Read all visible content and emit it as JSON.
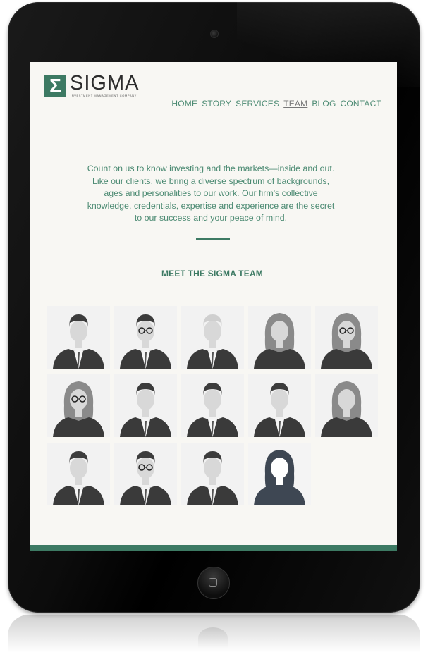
{
  "brand": {
    "mark": "Σ",
    "name": "SIGMA",
    "tagline": "INVESTMENT MANAGEMENT COMPANY"
  },
  "nav": {
    "items": [
      {
        "label": "HOME",
        "active": false
      },
      {
        "label": "STORY",
        "active": false
      },
      {
        "label": "SERVICES",
        "active": false
      },
      {
        "label": "TEAM",
        "active": true
      },
      {
        "label": "BLOG",
        "active": false
      },
      {
        "label": "CONTACT",
        "active": false
      }
    ]
  },
  "intro": {
    "text": "Count on us to know investing and the markets—inside and out. Like our clients, we bring a diverse spectrum of backgrounds, ages and personalities to our work. Our firm's collective knowledge, credentials, expertise and experience are the secret to our success and your peace of mind."
  },
  "team": {
    "heading": "MEET THE SIGMA TEAM",
    "members": [
      {
        "icon": "portrait-man-photo"
      },
      {
        "icon": "portrait-man-glasses-photo"
      },
      {
        "icon": "portrait-man-bald-photo"
      },
      {
        "icon": "portrait-woman-long-hair-photo"
      },
      {
        "icon": "portrait-woman-glasses-photo"
      },
      {
        "icon": "portrait-woman-glasses-photo"
      },
      {
        "icon": "portrait-man-photo"
      },
      {
        "icon": "portrait-man-photo"
      },
      {
        "icon": "portrait-man-photo"
      },
      {
        "icon": "portrait-woman-photo"
      },
      {
        "icon": "portrait-man-young-photo"
      },
      {
        "icon": "portrait-man-glasses-photo"
      },
      {
        "icon": "portrait-man-photo"
      },
      {
        "icon": "placeholder-woman-silhouette-icon"
      }
    ]
  },
  "colors": {
    "accent": "#3d7a63",
    "text_accent": "#4b8a72",
    "screen_bg": "#f8f7f3",
    "device": "#0b0b0b"
  }
}
